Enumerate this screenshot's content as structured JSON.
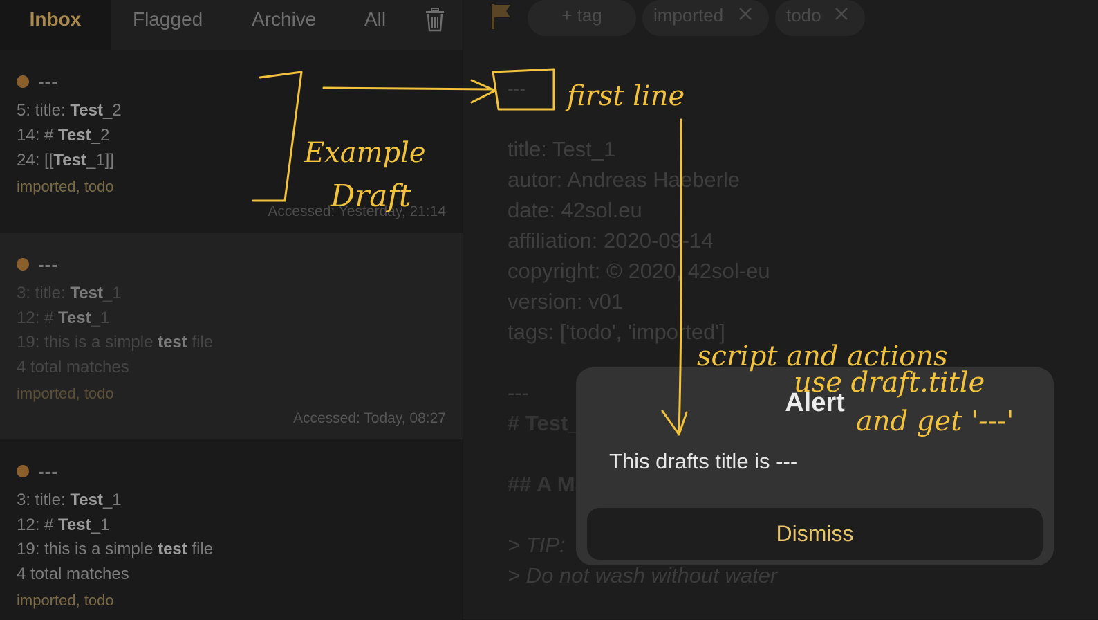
{
  "tabs": {
    "inbox": "Inbox",
    "flagged": "Flagged",
    "archive": "Archive",
    "all": "All"
  },
  "icons": {
    "trash": "trash-icon",
    "flag": "flag-icon",
    "close": "close-icon"
  },
  "colors": {
    "accent": "#a8884f",
    "dot": "#8a5f2c",
    "annotation": "#f2c23c",
    "dismiss": "#e7c56a"
  },
  "cards": [
    {
      "title": "---",
      "lines": [
        {
          "pre": "5: title: ",
          "bold": "Test",
          "post": "_2"
        },
        {
          "pre": "14: # ",
          "bold": "Test",
          "post": "_2"
        },
        {
          "pre": "24: [[",
          "bold": "Test",
          "post": "_1]]"
        }
      ],
      "tags": "imported, todo",
      "accessed": "Accessed: Yesterday, 21:14"
    },
    {
      "title": "---",
      "lines": [
        {
          "pre": "3: title: ",
          "bold": "Test",
          "post": "_1"
        },
        {
          "pre": "12: # ",
          "bold": "Test",
          "post": "_1"
        },
        {
          "pre": "19: this is a simple ",
          "bold": "test",
          "post": " file"
        },
        {
          "pre": "4 total matches",
          "bold": "",
          "post": ""
        }
      ],
      "tags": "imported, todo",
      "accessed": "Accessed: Today, 08:27"
    },
    {
      "title": "---",
      "lines": [
        {
          "pre": "3: title: ",
          "bold": "Test",
          "post": "_1"
        },
        {
          "pre": "12: # ",
          "bold": "Test",
          "post": "_1"
        },
        {
          "pre": "19: this is a simple ",
          "bold": "test",
          "post": " file"
        },
        {
          "pre": "4 total matches",
          "bold": "",
          "post": ""
        }
      ],
      "tags": "imported, todo"
    }
  ],
  "tagbar": {
    "add": "+ tag",
    "tags": [
      "imported",
      "todo"
    ]
  },
  "editor": {
    "first_line": "---",
    "l1": "title: Test_1",
    "l2": "autor: Andreas Haeberle",
    "l3": "date: 42sol.eu",
    "l4": "affiliation: 2020-09-14",
    "l5": "copyright: © 2020, 42sol-eu",
    "l6": "version: v01",
    "l7": "tags: ['todo', 'imported']",
    "l8": "---",
    "h1": "# Test_1",
    "h2": "## A Markdown",
    "q1": "> TIP:",
    "q2": "> Do not wash without water"
  },
  "alert": {
    "title": "Alert",
    "message": "This drafts title is ---",
    "button": "Dismiss"
  },
  "annotation": {
    "example1": "Example",
    "example2": "Draft",
    "first_line": "first line",
    "note1": "script and actions",
    "note2": "use draft.title",
    "note3": "and get '---'"
  }
}
